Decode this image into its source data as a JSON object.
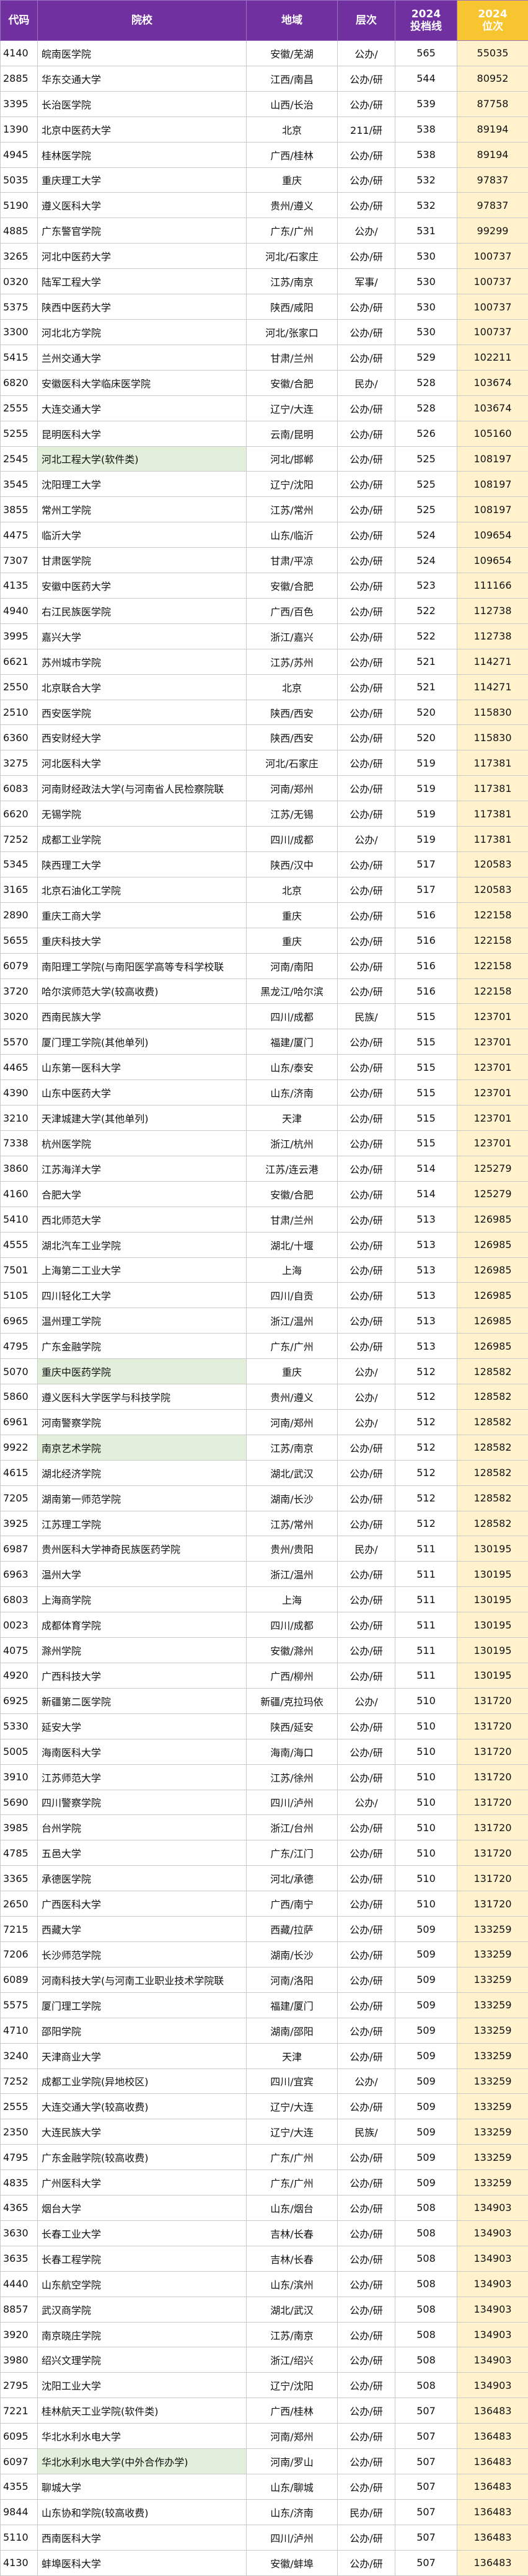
{
  "headers": [
    "代码",
    "院校",
    "地域",
    "层次",
    "2024\n投档线",
    "2024\n位次"
  ],
  "colors": {
    "header_bg": "#7030a0",
    "rank_header_bg": "#f6c530",
    "rank_cell_bg": "#fff2cc",
    "highlight_bg": "#e2efda"
  },
  "rows": [
    [
      "4140",
      "皖南医学院",
      "安徽/芜湖",
      "公办/",
      "565",
      "55035",
      0
    ],
    [
      "2885",
      "华东交通大学",
      "江西/南昌",
      "公办/研",
      "544",
      "80952",
      0
    ],
    [
      "3395",
      "长治医学院",
      "山西/长治",
      "公办/研",
      "539",
      "87758",
      0
    ],
    [
      "1390",
      "北京中医药大学",
      "北京",
      "211/研",
      "538",
      "89194",
      0
    ],
    [
      "4945",
      "桂林医学院",
      "广西/桂林",
      "公办/研",
      "538",
      "89194",
      0
    ],
    [
      "5035",
      "重庆理工大学",
      "重庆",
      "公办/研",
      "532",
      "97837",
      0
    ],
    [
      "5190",
      "遵义医科大学",
      "贵州/遵义",
      "公办/研",
      "532",
      "97837",
      0
    ],
    [
      "4885",
      "广东警官学院",
      "广东/广州",
      "公办/",
      "531",
      "99299",
      0
    ],
    [
      "3265",
      "河北中医药大学",
      "河北/石家庄",
      "公办/研",
      "530",
      "100737",
      0
    ],
    [
      "0320",
      "陆军工程大学",
      "江苏/南京",
      "军事/",
      "530",
      "100737",
      0
    ],
    [
      "5375",
      "陕西中医药大学",
      "陕西/咸阳",
      "公办/研",
      "530",
      "100737",
      0
    ],
    [
      "3300",
      "河北北方学院",
      "河北/张家口",
      "公办/研",
      "530",
      "100737",
      0
    ],
    [
      "5415",
      "兰州交通大学",
      "甘肃/兰州",
      "公办/研",
      "529",
      "102211",
      0
    ],
    [
      "6820",
      "安徽医科大学临床医学院",
      "安徽/合肥",
      "民办/",
      "528",
      "103674",
      0
    ],
    [
      "2555",
      "大连交通大学",
      "辽宁/大连",
      "公办/研",
      "528",
      "103674",
      0
    ],
    [
      "5255",
      "昆明医科大学",
      "云南/昆明",
      "公办/研",
      "526",
      "105160",
      0
    ],
    [
      "2545",
      "河北工程大学(软件类)",
      "河北/邯郸",
      "公办/研",
      "525",
      "108197",
      1
    ],
    [
      "3545",
      "沈阳理工大学",
      "辽宁/沈阳",
      "公办/研",
      "525",
      "108197",
      0
    ],
    [
      "3855",
      "常州工学院",
      "江苏/常州",
      "公办/研",
      "525",
      "108197",
      0
    ],
    [
      "4475",
      "临沂大学",
      "山东/临沂",
      "公办/研",
      "524",
      "109654",
      0
    ],
    [
      "7307",
      "甘肃医学院",
      "甘肃/平凉",
      "公办/研",
      "524",
      "109654",
      0
    ],
    [
      "4135",
      "安徽中医药大学",
      "安徽/合肥",
      "公办/研",
      "523",
      "111166",
      0
    ],
    [
      "4940",
      "右江民族医学院",
      "广西/百色",
      "公办/研",
      "522",
      "112738",
      0
    ],
    [
      "3995",
      "嘉兴大学",
      "浙江/嘉兴",
      "公办/研",
      "522",
      "112738",
      0
    ],
    [
      "6621",
      "苏州城市学院",
      "江苏/苏州",
      "公办/研",
      "521",
      "114271",
      0
    ],
    [
      "2550",
      "北京联合大学",
      "北京",
      "公办/研",
      "521",
      "114271",
      0
    ],
    [
      "2510",
      "西安医学院",
      "陕西/西安",
      "公办/研",
      "520",
      "115830",
      0
    ],
    [
      "6360",
      "西安财经大学",
      "陕西/西安",
      "公办/研",
      "520",
      "115830",
      0
    ],
    [
      "3275",
      "河北医科大学",
      "河北/石家庄",
      "公办/研",
      "519",
      "117381",
      0
    ],
    [
      "6083",
      "河南财经政法大学(与河南省人民检察院联",
      "河南/郑州",
      "公办/研",
      "519",
      "117381",
      0
    ],
    [
      "6620",
      "无锡学院",
      "江苏/无锡",
      "公办/研",
      "519",
      "117381",
      0
    ],
    [
      "7252",
      "成都工业学院",
      "四川/成都",
      "公办/",
      "519",
      "117381",
      0
    ],
    [
      "5345",
      "陕西理工大学",
      "陕西/汉中",
      "公办/研",
      "517",
      "120583",
      0
    ],
    [
      "3165",
      "北京石油化工学院",
      "北京",
      "公办/研",
      "517",
      "120583",
      0
    ],
    [
      "2890",
      "重庆工商大学",
      "重庆",
      "公办/研",
      "516",
      "122158",
      0
    ],
    [
      "5655",
      "重庆科技大学",
      "重庆",
      "公办/研",
      "516",
      "122158",
      0
    ],
    [
      "6079",
      "南阳理工学院(与南阳医学高等专科学校联",
      "河南/南阳",
      "公办/研",
      "516",
      "122158",
      0
    ],
    [
      "3720",
      "哈尔滨师范大学(较高收费)",
      "黑龙江/哈尔滨",
      "公办/研",
      "516",
      "122158",
      0
    ],
    [
      "3020",
      "西南民族大学",
      "四川/成都",
      "民族/",
      "515",
      "123701",
      0
    ],
    [
      "5570",
      "厦门理工学院(其他单列)",
      "福建/厦门",
      "公办/研",
      "515",
      "123701",
      0
    ],
    [
      "4465",
      "山东第一医科大学",
      "山东/泰安",
      "公办/研",
      "515",
      "123701",
      0
    ],
    [
      "4390",
      "山东中医药大学",
      "山东/济南",
      "公办/研",
      "515",
      "123701",
      0
    ],
    [
      "3210",
      "天津城建大学(其他单列)",
      "天津",
      "公办/研",
      "515",
      "123701",
      0
    ],
    [
      "7338",
      "杭州医学院",
      "浙江/杭州",
      "公办/研",
      "515",
      "123701",
      0
    ],
    [
      "3860",
      "江苏海洋大学",
      "江苏/连云港",
      "公办/研",
      "514",
      "125279",
      0
    ],
    [
      "4160",
      "合肥大学",
      "安徽/合肥",
      "公办/研",
      "514",
      "125279",
      0
    ],
    [
      "5410",
      "西北师范大学",
      "甘肃/兰州",
      "公办/研",
      "513",
      "126985",
      0
    ],
    [
      "4555",
      "湖北汽车工业学院",
      "湖北/十堰",
      "公办/研",
      "513",
      "126985",
      0
    ],
    [
      "7501",
      "上海第二工业大学",
      "上海",
      "公办/研",
      "513",
      "126985",
      0
    ],
    [
      "5105",
      "四川轻化工大学",
      "四川/自贡",
      "公办/研",
      "513",
      "126985",
      0
    ],
    [
      "6965",
      "温州理工学院",
      "浙江/温州",
      "公办/研",
      "513",
      "126985",
      0
    ],
    [
      "4795",
      "广东金融学院",
      "广东/广州",
      "公办/研",
      "513",
      "126985",
      0
    ],
    [
      "5070",
      "重庆中医药学院",
      "重庆",
      "公办/",
      "512",
      "128582",
      1
    ],
    [
      "5860",
      "遵义医科大学医学与科技学院",
      "贵州/遵义",
      "公办/",
      "512",
      "128582",
      0
    ],
    [
      "6961",
      "河南警察学院",
      "河南/郑州",
      "公办/",
      "512",
      "128582",
      0
    ],
    [
      "9922",
      "南京艺术学院",
      "江苏/南京",
      "公办/研",
      "512",
      "128582",
      1
    ],
    [
      "4615",
      "湖北经济学院",
      "湖北/武汉",
      "公办/研",
      "512",
      "128582",
      0
    ],
    [
      "7205",
      "湖南第一师范学院",
      "湖南/长沙",
      "公办/研",
      "512",
      "128582",
      0
    ],
    [
      "3925",
      "江苏理工学院",
      "江苏/常州",
      "公办/研",
      "512",
      "128582",
      0
    ],
    [
      "6987",
      "贵州医科大学神奇民族医药学院",
      "贵州/贵阳",
      "民办/",
      "511",
      "130195",
      0
    ],
    [
      "6963",
      "温州大学",
      "浙江/温州",
      "公办/研",
      "511",
      "130195",
      0
    ],
    [
      "6803",
      "上海商学院",
      "上海",
      "公办/研",
      "511",
      "130195",
      0
    ],
    [
      "0023",
      "成都体育学院",
      "四川/成都",
      "公办/研",
      "511",
      "130195",
      0
    ],
    [
      "4075",
      "滁州学院",
      "安徽/滁州",
      "公办/研",
      "511",
      "130195",
      0
    ],
    [
      "4920",
      "广西科技大学",
      "广西/柳州",
      "公办/研",
      "511",
      "130195",
      0
    ],
    [
      "6925",
      "新疆第二医学院",
      "新疆/克拉玛依",
      "公办/",
      "510",
      "131720",
      0
    ],
    [
      "5330",
      "延安大学",
      "陕西/延安",
      "公办/研",
      "510",
      "131720",
      0
    ],
    [
      "5005",
      "海南医科大学",
      "海南/海口",
      "公办/研",
      "510",
      "131720",
      0
    ],
    [
      "3910",
      "江苏师范大学",
      "江苏/徐州",
      "公办/研",
      "510",
      "131720",
      0
    ],
    [
      "5690",
      "四川警察学院",
      "四川/泸州",
      "公办/",
      "510",
      "131720",
      0
    ],
    [
      "3985",
      "台州学院",
      "浙江/台州",
      "公办/研",
      "510",
      "131720",
      0
    ],
    [
      "4785",
      "五邑大学",
      "广东/江门",
      "公办/研",
      "510",
      "131720",
      0
    ],
    [
      "3365",
      "承德医学院",
      "河北/承德",
      "公办/研",
      "510",
      "131720",
      0
    ],
    [
      "2650",
      "广西医科大学",
      "广西/南宁",
      "公办/研",
      "510",
      "131720",
      0
    ],
    [
      "7215",
      "西藏大学",
      "西藏/拉萨",
      "公办/研",
      "509",
      "133259",
      0
    ],
    [
      "7206",
      "长沙师范学院",
      "湖南/长沙",
      "公办/研",
      "509",
      "133259",
      0
    ],
    [
      "6089",
      "河南科技大学(与河南工业职业技术学院联",
      "河南/洛阳",
      "公办/研",
      "509",
      "133259",
      0
    ],
    [
      "5575",
      "厦门理工学院",
      "福建/厦门",
      "公办/研",
      "509",
      "133259",
      0
    ],
    [
      "4710",
      "邵阳学院",
      "湖南/邵阳",
      "公办/研",
      "509",
      "133259",
      0
    ],
    [
      "3240",
      "天津商业大学",
      "天津",
      "公办/研",
      "509",
      "133259",
      0
    ],
    [
      "7252",
      "成都工业学院(异地校区)",
      "四川/宜宾",
      "公办/",
      "509",
      "133259",
      0
    ],
    [
      "2555",
      "大连交通大学(较高收费)",
      "辽宁/大连",
      "公办/研",
      "509",
      "133259",
      0
    ],
    [
      "2350",
      "大连民族大学",
      "辽宁/大连",
      "民族/",
      "509",
      "133259",
      0
    ],
    [
      "4795",
      "广东金融学院(较高收费)",
      "广东/广州",
      "公办/研",
      "509",
      "133259",
      0
    ],
    [
      "4835",
      "广州医科大学",
      "广东/广州",
      "公办/研",
      "509",
      "133259",
      0
    ],
    [
      "4365",
      "烟台大学",
      "山东/烟台",
      "公办/研",
      "508",
      "134903",
      0
    ],
    [
      "3630",
      "长春工业大学",
      "吉林/长春",
      "公办/研",
      "508",
      "134903",
      0
    ],
    [
      "3635",
      "长春工程学院",
      "吉林/长春",
      "公办/研",
      "508",
      "134903",
      0
    ],
    [
      "4440",
      "山东航空学院",
      "山东/滨州",
      "公办/研",
      "508",
      "134903",
      0
    ],
    [
      "8857",
      "武汉商学院",
      "湖北/武汉",
      "公办/研",
      "508",
      "134903",
      0
    ],
    [
      "3920",
      "南京晓庄学院",
      "江苏/南京",
      "公办/研",
      "508",
      "134903",
      0
    ],
    [
      "3980",
      "绍兴文理学院",
      "浙江/绍兴",
      "公办/研",
      "508",
      "134903",
      0
    ],
    [
      "2795",
      "沈阳工业大学",
      "辽宁/沈阳",
      "公办/研",
      "508",
      "134903",
      0
    ],
    [
      "7221",
      "桂林航天工业学院(软件类)",
      "广西/桂林",
      "公办/研",
      "507",
      "136483",
      0
    ],
    [
      "6095",
      "华北水利水电大学",
      "河南/郑州",
      "公办/研",
      "507",
      "136483",
      0
    ],
    [
      "6097",
      "华北水利水电大学(中外合作办学)",
      "河南/罗山",
      "公办/研",
      "507",
      "136483",
      1
    ],
    [
      "4355",
      "聊城大学",
      "山东/聊城",
      "公办/研",
      "507",
      "136483",
      0
    ],
    [
      "9844",
      "山东协和学院(较高收费)",
      "山东/济南",
      "民办/研",
      "507",
      "136483",
      0
    ],
    [
      "5110",
      "西南医科大学",
      "四川/泸州",
      "公办/研",
      "507",
      "136483",
      0
    ],
    [
      "4130",
      "蚌埠医科大学",
      "安徽/蚌埠",
      "公办/研",
      "507",
      "136483",
      0
    ]
  ]
}
